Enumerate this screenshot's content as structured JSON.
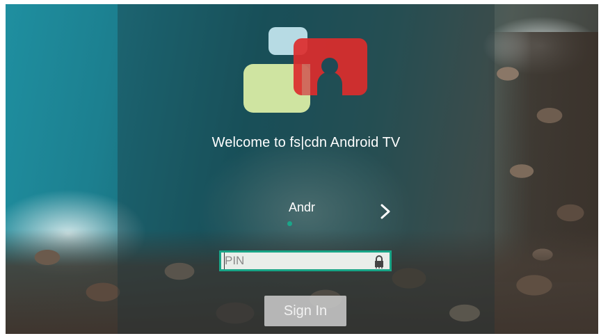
{
  "welcome_text": "Welcome to fs|cdn Android TV",
  "user": {
    "name": "Andr"
  },
  "pin": {
    "placeholder": "PIN",
    "value": ""
  },
  "sign_in_label": "Sign In",
  "icons": {
    "logo": "fscdn-logo",
    "next": "chevron-right-icon",
    "lock": "lock-icon"
  },
  "colors": {
    "accent": "#18a587",
    "logo_red": "#d93a3a",
    "logo_green": "#cfe4a3",
    "logo_blue": "#b5d8e2"
  }
}
